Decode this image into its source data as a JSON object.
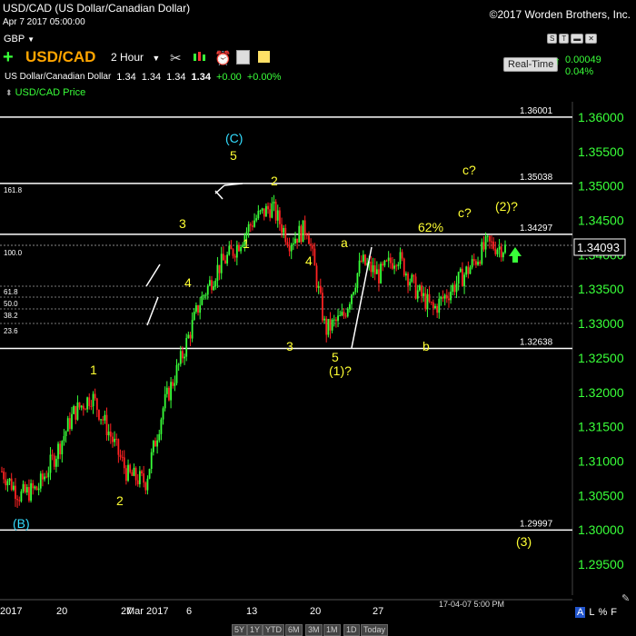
{
  "header": {
    "title": "USD/CAD (US Dollar/Canadian Dollar)",
    "datetime": "Apr 7 2017 05:00:00",
    "copyright": "©2017 Worden Brothers, Inc.",
    "currency": "GBP",
    "symbol": "USD/CAD",
    "interval": "2 Hour",
    "realtime_label": "Real-Time",
    "change_abs": "0.00049",
    "change_pct": "0.04%",
    "quote_name": "US Dollar/Canadian Dollar",
    "quote_o": "1.34",
    "quote_h": "1.34",
    "quote_l": "1.34",
    "quote_c": "1.34",
    "quote_chg": "+0.00",
    "quote_chgpct": "+0.00%",
    "price_label": "USD/CAD Price",
    "small_buttons": [
      "S",
      "T",
      "▬",
      "✕"
    ]
  },
  "footer": {
    "timestamp": "17-04-07 5:00 PM",
    "ranges": [
      "5Y",
      "1Y",
      "YTD",
      "6M",
      "3M",
      "1M",
      "1D",
      "Today"
    ],
    "scale_a": "A",
    "scale_l": "L",
    "scale_pct": "%",
    "scale_f": "F"
  },
  "colors": {
    "up": "#39ff39",
    "down": "#ff2222",
    "wave_yellow": "#ffff33",
    "wave_cyan": "#33ddff",
    "hline": "#ffffff",
    "last_price_box": "#ffffff"
  },
  "chart_data": {
    "type": "candlestick",
    "y_axis_labels": [
      "1.36000",
      "1.35500",
      "1.35000",
      "1.34500",
      "1.34000",
      "1.33500",
      "1.33000",
      "1.32500",
      "1.32000",
      "1.31500",
      "1.31000",
      "1.30500",
      "1.30000",
      "1.29500"
    ],
    "ylim": [
      1.2935,
      1.3645
    ],
    "x_axis_labels": [
      "2017",
      "20",
      "27",
      "Mar 2017",
      "6",
      "13",
      "20",
      "27"
    ],
    "last_price": "1.34093",
    "horizontal_lines": [
      {
        "label": "1.36001",
        "value": 1.36001
      },
      {
        "label": "1.35038",
        "value": 1.35038
      },
      {
        "label": "1.34297",
        "value": 1.34297
      },
      {
        "label": "1.32638",
        "value": 1.32638
      },
      {
        "label": "1.29997",
        "value": 1.29997
      }
    ],
    "fib_labels": [
      "161.8",
      "100.0",
      "61.8",
      "50.0",
      "38.2",
      "23.6"
    ],
    "wave_labels": [
      "(C)",
      "5",
      "2",
      "3",
      "1",
      "4",
      "a",
      "62%",
      "c?",
      "c?",
      "(2)?",
      "4",
      "3",
      "5",
      "(1)?",
      "b",
      "1",
      "2",
      "(B)",
      "(3)"
    ],
    "close_path": [
      [
        0,
        1.3085
      ],
      [
        1,
        1.305
      ],
      [
        2,
        1.306
      ],
      [
        3,
        1.311
      ],
      [
        4,
        1.317
      ],
      [
        5,
        1.3195
      ],
      [
        6,
        1.314
      ],
      [
        7,
        1.308
      ],
      [
        8,
        1.307
      ],
      [
        9,
        1.318
      ],
      [
        10,
        1.325
      ],
      [
        11,
        1.333
      ],
      [
        12,
        1.338
      ],
      [
        13,
        1.341
      ],
      [
        14,
        1.345
      ],
      [
        15,
        1.347
      ],
      [
        16,
        1.342
      ],
      [
        17,
        1.344
      ],
      [
        18,
        1.329
      ],
      [
        19,
        1.331
      ],
      [
        20,
        1.339
      ],
      [
        21,
        1.337
      ],
      [
        22,
        1.34
      ],
      [
        23,
        1.335
      ],
      [
        24,
        1.332
      ],
      [
        25,
        1.335
      ],
      [
        26,
        1.338
      ],
      [
        27,
        1.3415
      ],
      [
        28,
        1.341
      ]
    ]
  }
}
